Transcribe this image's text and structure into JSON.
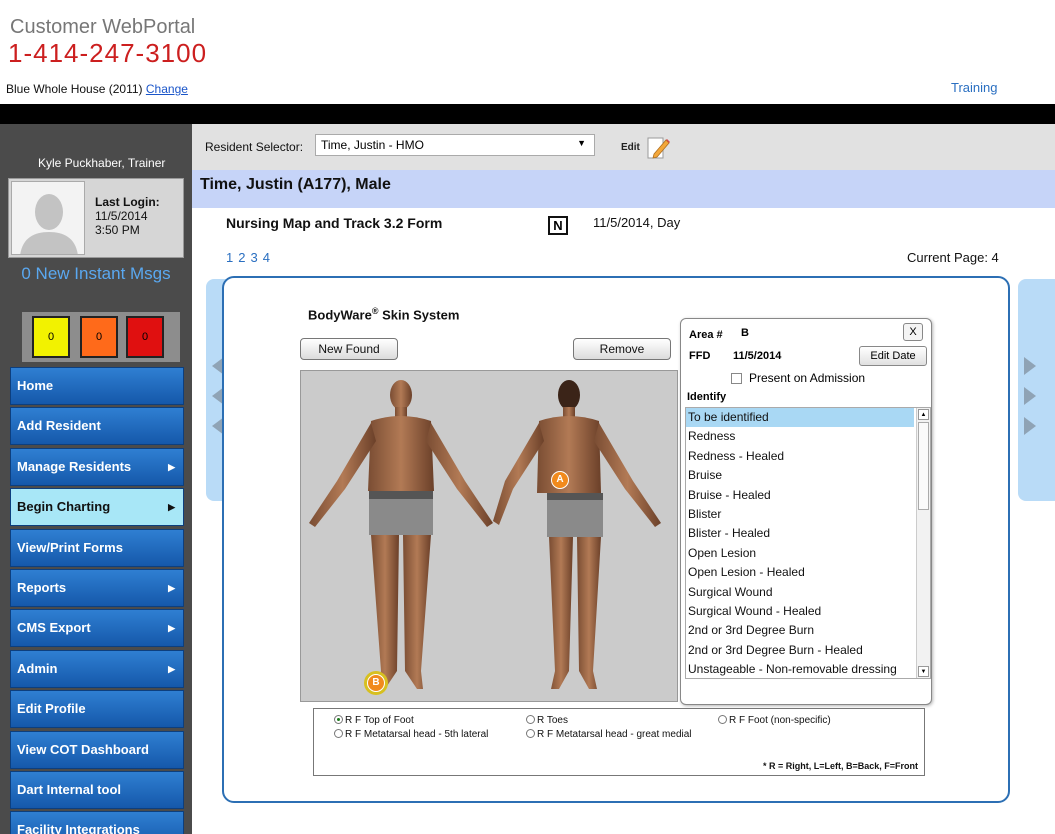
{
  "header": {
    "portal_title": "Customer WebPortal",
    "phone": "1-414-247-3100",
    "facility": "Blue Whole House (2011)",
    "change_link": "Change",
    "training_link": "Training"
  },
  "sidebar": {
    "user_name": "Kyle Puckhaber, Trainer",
    "last_login_label": "Last Login:",
    "last_login_date": "11/5/2014",
    "last_login_time": "3:50 PM",
    "instant_msgs": "0 New Instant Msgs",
    "alerts": {
      "yellow": "0",
      "orange": "0",
      "red": "0"
    },
    "menu": [
      {
        "label": "Home",
        "has_arrow": false
      },
      {
        "label": "Add Resident",
        "has_arrow": false
      },
      {
        "label": "Manage Residents",
        "has_arrow": true
      },
      {
        "label": "Begin Charting",
        "has_arrow": true,
        "active": true
      },
      {
        "label": "View/Print Forms",
        "has_arrow": false
      },
      {
        "label": "Reports",
        "has_arrow": true
      },
      {
        "label": "CMS Export",
        "has_arrow": true
      },
      {
        "label": "Admin",
        "has_arrow": true
      },
      {
        "label": "Edit Profile",
        "has_arrow": false
      },
      {
        "label": "View COT Dashboard",
        "has_arrow": false
      },
      {
        "label": "Dart Internal tool",
        "has_arrow": false
      },
      {
        "label": "Facility Integrations",
        "has_arrow": false
      }
    ]
  },
  "selector": {
    "label": "Resident Selector:",
    "value": "Time, Justin - HMO",
    "edit_label": "Edit"
  },
  "resident": {
    "heading": "Time, Justin (A177), Male"
  },
  "form": {
    "title": "Nursing Map and Track 3.2 Form",
    "badge": "N",
    "date": "11/5/2014, Day",
    "pages": [
      "1",
      "2",
      "3",
      "4"
    ],
    "current_page": "Current Page: 4"
  },
  "bodyware": {
    "title_main": "BodyWare",
    "title_reg": "®",
    "title_rest": " Skin System",
    "new_found_label": "New Found",
    "remove_label": "Remove",
    "markers": {
      "a": "A",
      "b": "B"
    }
  },
  "identify_panel": {
    "area_label": "Area #",
    "area_value": "B",
    "close_label": "X",
    "ffd_label": "FFD",
    "ffd_value": "11/5/2014",
    "edit_date_label": "Edit Date",
    "present_label": "Present on Admission",
    "identify_label": "Identify",
    "items": [
      "To be identified",
      "Redness",
      "Redness - Healed",
      "Bruise",
      "Bruise - Healed",
      "Blister",
      "Blister - Healed",
      "Open Lesion",
      "Open Lesion - Healed",
      "Surgical Wound",
      "Surgical Wound - Healed",
      "2nd or 3rd Degree Burn",
      "2nd or 3rd Degree Burn - Healed",
      "Unstageable - Non-removable dressing"
    ],
    "selected_index": 0
  },
  "locations": {
    "options": [
      {
        "label": "R F Top of Foot",
        "selected": true
      },
      {
        "label": "R Toes",
        "selected": false
      },
      {
        "label": "R F Foot (non-specific)",
        "selected": false
      },
      {
        "label": "R F Metatarsal head - 5th lateral",
        "selected": false
      },
      {
        "label": "R F Metatarsal head - great medial",
        "selected": false
      }
    ],
    "legend": "* R = Right, L=Left, B=Back, F=Front"
  },
  "colors": {
    "phone_red": "#cc1f1f",
    "menu_blue": "#1f6ac0",
    "menu_active": "#a8e7f7",
    "name_bar": "#c6d4f8",
    "panel_border": "#2c6fb4",
    "marker_orange": "#f18a1d"
  },
  "icons": [
    "avatar-silhouette",
    "edit-pencil-icon",
    "chevron-left-icon",
    "chevron-right-icon",
    "dropdown-caret-icon"
  ]
}
